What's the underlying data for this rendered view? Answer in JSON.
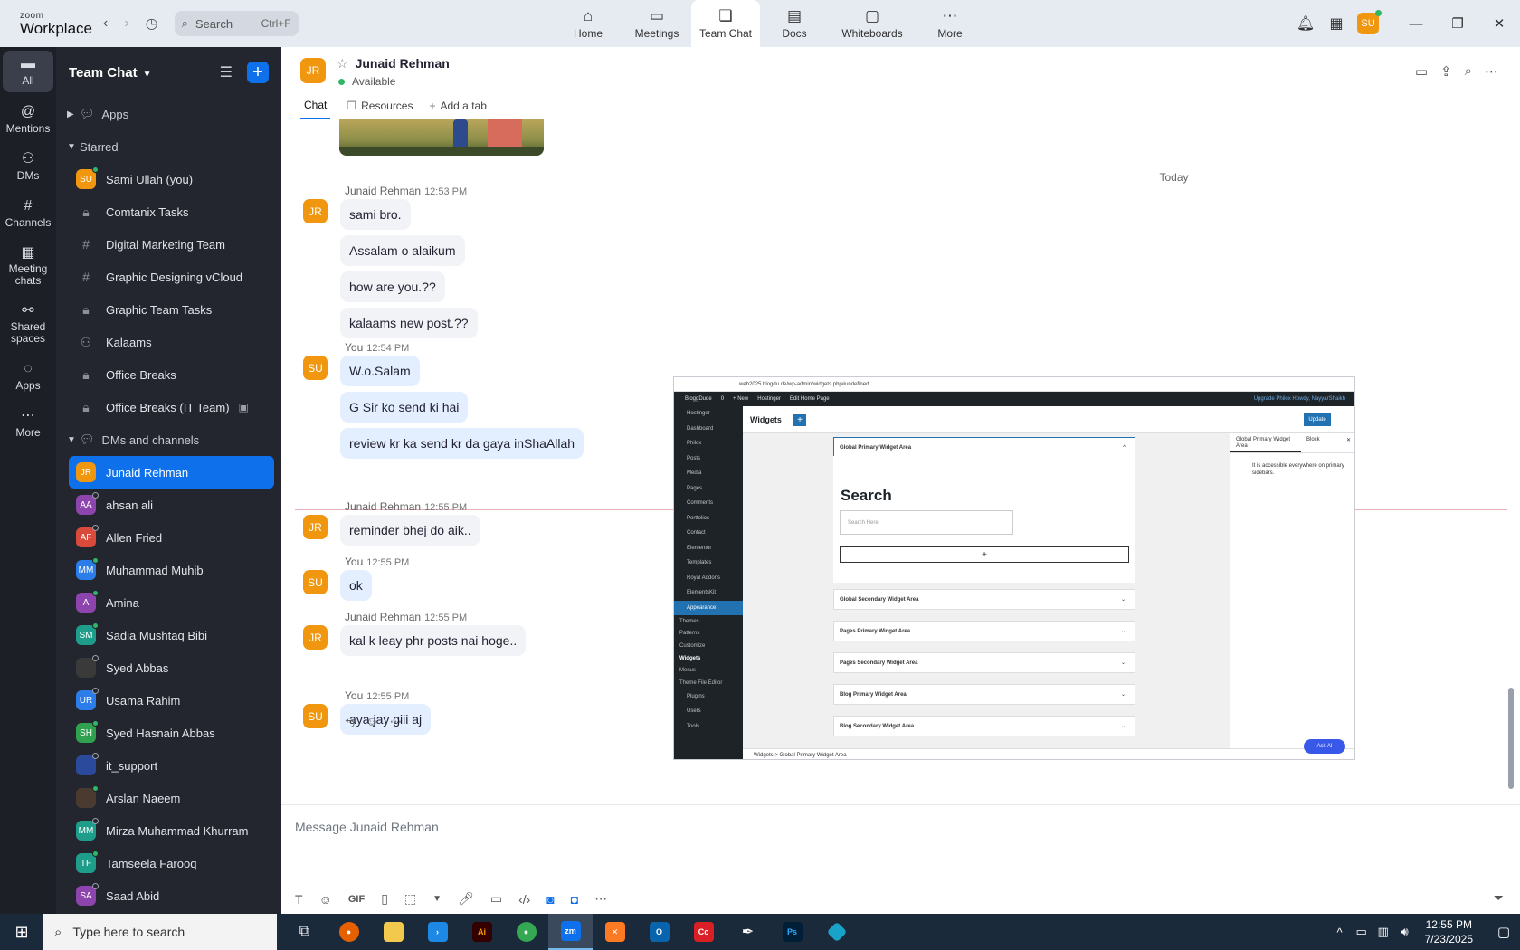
{
  "app": {
    "logo_top": "zoom",
    "logo_bottom": "Workplace"
  },
  "topbar": {
    "search_placeholder": "Search",
    "search_shortcut": "Ctrl+F",
    "tabs": [
      {
        "label": "Home",
        "icon": "home-icon"
      },
      {
        "label": "Meetings",
        "icon": "video-camera-icon"
      },
      {
        "label": "Team Chat",
        "icon": "chat-bubble-icon"
      },
      {
        "label": "Docs",
        "icon": "document-icon"
      },
      {
        "label": "Whiteboards",
        "icon": "whiteboard-icon"
      },
      {
        "label": "More",
        "icon": "more-dots-icon"
      }
    ],
    "user_initials": "SU"
  },
  "rail": {
    "items": [
      {
        "label": "All"
      },
      {
        "label": "Mentions"
      },
      {
        "label": "DMs"
      },
      {
        "label": "Channels"
      },
      {
        "label": "Meeting chats"
      },
      {
        "label": "Shared spaces"
      },
      {
        "label": "Apps"
      },
      {
        "label": "More"
      }
    ]
  },
  "sidebar": {
    "title": "Team Chat",
    "sections": {
      "apps": "Apps",
      "starred": "Starred",
      "dms": "DMs and channels"
    },
    "starred": [
      {
        "label": "Sami Ullah (you)",
        "initials": "SU",
        "color": "#f0960f"
      },
      {
        "label": "Comtanix Tasks"
      },
      {
        "label": "Digital Marketing Team"
      },
      {
        "label": "Graphic Designing vCloud"
      },
      {
        "label": "Graphic Team Tasks"
      },
      {
        "label": "Kalaams"
      },
      {
        "label": "Office Breaks"
      },
      {
        "label": "Office Breaks (IT Team)"
      }
    ],
    "dms": [
      {
        "label": "Junaid Rehman",
        "initials": "JR",
        "color": "#f0960f"
      },
      {
        "label": "ahsan ali",
        "initials": "AA",
        "color": "#8e44ad"
      },
      {
        "label": "Allen Fried",
        "initials": "AF",
        "color": "#d94a3b"
      },
      {
        "label": "Muhammad Muhib",
        "initials": "MM",
        "color": "#2b7de9"
      },
      {
        "label": "Amina",
        "initials": "A",
        "color": "#8e44ad"
      },
      {
        "label": "Sadia Mushtaq Bibi",
        "initials": "SM",
        "color": "#1f9d8b"
      },
      {
        "label": "Syed Abbas",
        "initials": "",
        "color": "#3a3a3a"
      },
      {
        "label": "Usama Rahim",
        "initials": "UR",
        "color": "#2b7de9"
      },
      {
        "label": "Syed Hasnain Abbas",
        "initials": "SH",
        "color": "#2fa14f"
      },
      {
        "label": "it_support",
        "initials": "",
        "color": "#2b4a9c"
      },
      {
        "label": "Arslan Naeem",
        "initials": "",
        "color": "#4a3a30"
      },
      {
        "label": "Mirza Muhammad Khurram",
        "initials": "MM",
        "color": "#1f9d8b"
      },
      {
        "label": "Tamseela Farooq",
        "initials": "TF",
        "color": "#1f9d8b"
      },
      {
        "label": "Saad Abid",
        "initials": "SA",
        "color": "#8e44ad"
      }
    ]
  },
  "chat": {
    "contact_name": "Junaid Rehman",
    "contact_initials": "JR",
    "status": "Available",
    "tabs": {
      "chat": "Chat",
      "resources": "Resources",
      "add": "Add a tab"
    },
    "day_divider": "Today",
    "groups": [
      {
        "sender": "Junaid Rehman",
        "time": "12:53 PM",
        "initials": "JR",
        "mine": false,
        "messages": [
          "sami bro.",
          "Assalam o alaikum",
          "how are you.??",
          "kalaams new post.??"
        ]
      },
      {
        "sender": "You",
        "time": "12:54 PM",
        "initials": "SU",
        "mine": true,
        "messages": [
          "W.o.Salam",
          "G Sir ko send ki hai",
          "review kr ka send kr da gaya inShaAllah"
        ]
      },
      {
        "sender": "Junaid Rehman",
        "time": "12:55 PM",
        "initials": "JR",
        "mine": false,
        "messages": [
          "reminder bhej do aik.."
        ]
      },
      {
        "sender": "You",
        "time": "12:55 PM",
        "initials": "SU",
        "mine": true,
        "messages": [
          "ok"
        ]
      },
      {
        "sender": "Junaid Rehman",
        "time": "12:55 PM",
        "initials": "JR",
        "mine": false,
        "messages": [
          "kal k leay phr posts nai hoge.."
        ]
      },
      {
        "sender": "You",
        "time": "12:55 PM",
        "initials": "SU",
        "mine": true,
        "messages": [
          "aya jay giii aj"
        ]
      }
    ],
    "composer_placeholder": "Message Junaid Rehman"
  },
  "shared_screenshot": {
    "url": "web2025.blogdu.de/wp-admin/widgets.php#undefined",
    "admin_bar": [
      "BloggDude",
      "0",
      "+ New",
      "Hostinger",
      "Edit Home Page"
    ],
    "admin_bar_right": "Upgrade Philox   Howdy, NayyarShaikh",
    "menu": [
      "Hostinger",
      "Dashboard",
      "Philox",
      "Posts",
      "Media",
      "Pages",
      "Comments",
      "Portfolios",
      "Contact",
      "Elementor",
      "Templates",
      "Royal Addons",
      "ElementsKit",
      "Appearance"
    ],
    "submenu": [
      "Themes",
      "Patterns",
      "Customize",
      "Widgets",
      "Menus",
      "Theme File Editor"
    ],
    "menu_after": [
      "Plugins",
      "Users",
      "Tools"
    ],
    "page_title": "Widgets",
    "update_label": "Update",
    "open_area": "Global Primary Widget Area",
    "widget_title": "Search",
    "widget_placeholder": "Search Here",
    "areas": [
      "Global Secondary Widget Area",
      "Pages Primary Widget Area",
      "Pages Secondary Widget Area",
      "Blog Primary Widget Area",
      "Blog Secondary Widget Area"
    ],
    "panel_tab": "Global Primary Widget Area",
    "panel_tab2": "Block",
    "panel_desc": "It is accessible everywhere on primary sidebars.",
    "breadcrumb": "Widgets  >  Global Primary Widget Area",
    "ask_ai": "Ask AI"
  },
  "taskbar": {
    "search_placeholder": "Type here to search",
    "time": "12:55 PM",
    "date": "7/23/2025"
  }
}
